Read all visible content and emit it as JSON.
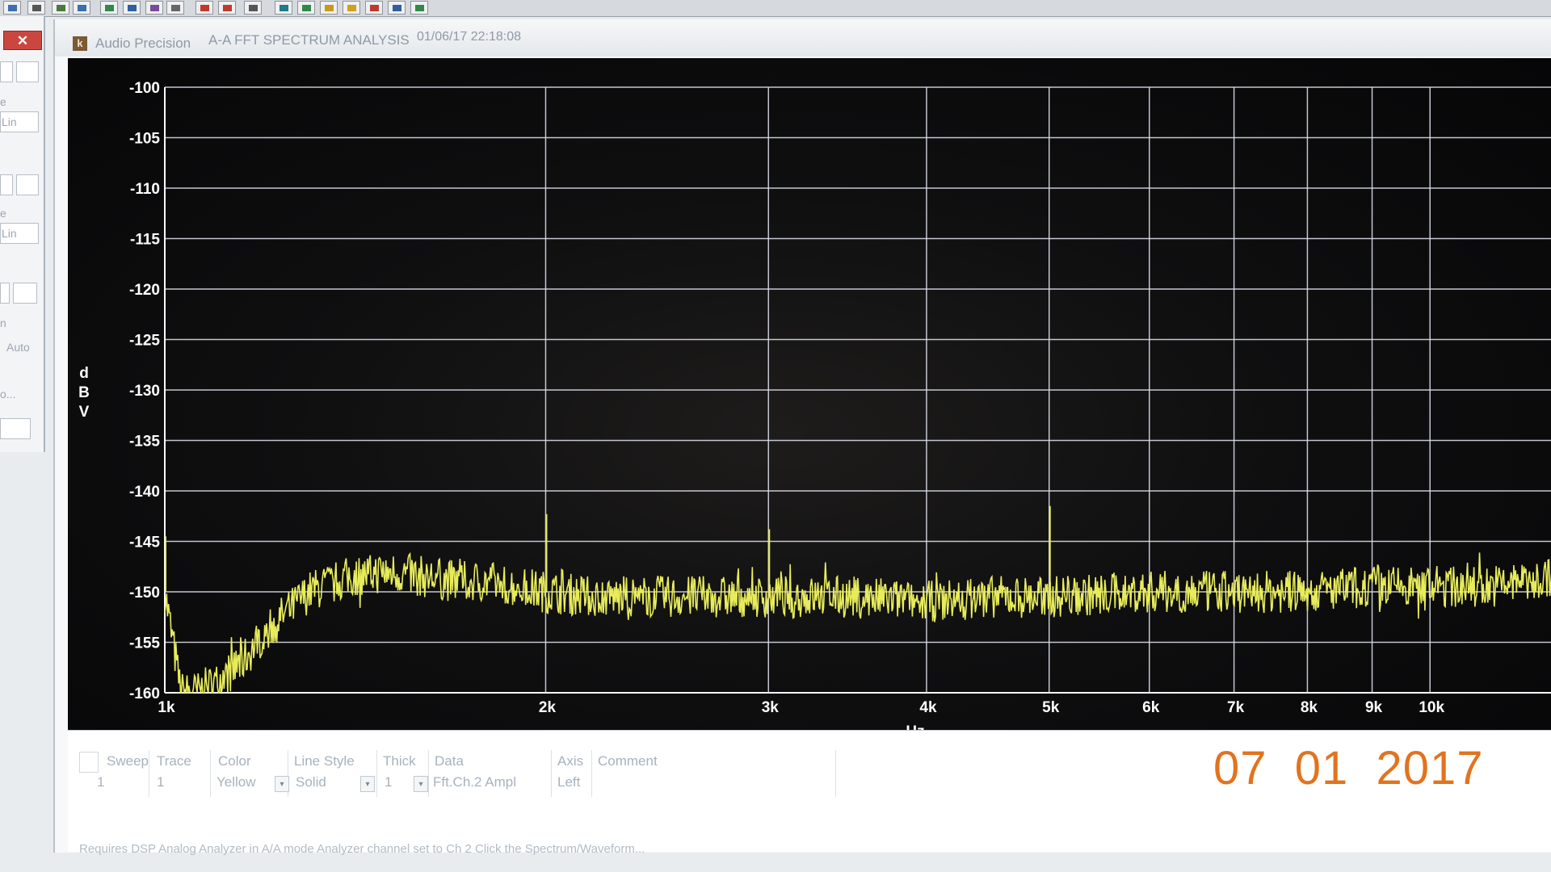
{
  "toolbar": {
    "buttons": [
      {
        "icon": "waveform-icon",
        "color": "#3a6fb0"
      },
      {
        "icon": "arrow-icon",
        "color": "#555555"
      },
      {
        "icon": "grid-icon",
        "color": "#4a7a3a"
      },
      {
        "icon": "split-icon",
        "color": "#3a6fb0"
      },
      {
        "icon": "import-icon",
        "color": "#2f8a4a"
      },
      {
        "icon": "download-icon",
        "color": "#2f5fa0"
      },
      {
        "icon": "chart-icon",
        "color": "#7a4a9a"
      },
      {
        "icon": "table-icon",
        "color": "#666666"
      },
      {
        "icon": "sweep-icon",
        "color": "#c0392b"
      },
      {
        "icon": "star-icon",
        "color": "#c0392b"
      },
      {
        "icon": "edit-icon",
        "color": "#555555"
      },
      {
        "icon": "graph-icon",
        "color": "#1f7a8c"
      },
      {
        "icon": "loop-icon",
        "color": "#2f8a4a"
      },
      {
        "icon": "scope-icon",
        "color": "#c99a1a"
      },
      {
        "icon": "bars-icon",
        "color": "#d4a017"
      },
      {
        "icon": "spectrum-icon",
        "color": "#c0392b"
      },
      {
        "icon": "monitor-icon",
        "color": "#2f5fa0"
      },
      {
        "icon": "lines-icon",
        "color": "#2f8a4a"
      }
    ]
  },
  "left_panel": {
    "close_label": "✕",
    "labels": [
      "e",
      "Lin",
      "e",
      "Lin",
      "n",
      "Auto",
      "o..."
    ]
  },
  "window": {
    "app_name": "Audio Precision",
    "analysis_name": "A-A FFT SPECTRUM ANALYSIS",
    "timestamp": "01/06/17 22:18:08"
  },
  "chart_data": {
    "type": "line",
    "title": "",
    "xlabel": "Hz",
    "ylabel": "dBV",
    "x_scale": "log",
    "xlim": [
      1000,
      12500
    ],
    "ylim": [
      -160,
      -100
    ],
    "grid": true,
    "legend": "none",
    "y_ticks": [
      -100,
      -105,
      -110,
      -115,
      -120,
      -125,
      -130,
      -135,
      -140,
      -145,
      -150,
      -155,
      -160
    ],
    "y_tick_labels": [
      "-100",
      "-105",
      "-110",
      "-115",
      "-120",
      "-125",
      "-130",
      "-135",
      "-140",
      "-145",
      "-150",
      "-155",
      "-160"
    ],
    "x_ticks": [
      1000,
      2000,
      3000,
      4000,
      5000,
      6000,
      7000,
      8000,
      9000,
      10000
    ],
    "x_tick_labels": [
      "1k",
      "2k",
      "3k",
      "4k",
      "5k",
      "6k",
      "7k",
      "8k",
      "9k",
      "10k"
    ],
    "series": [
      {
        "color": "#e8ec5a",
        "x": [
          1000,
          1030,
          1060,
          1100,
          1150,
          1200,
          1250,
          1300,
          1400,
          1500,
          1600,
          1700,
          1800,
          1900,
          2000,
          2200,
          2500,
          3000,
          3500,
          4000,
          4500,
          5000,
          6000,
          7000,
          8000,
          9000,
          10000,
          11000,
          12000,
          12500
        ],
        "values": [
          -150,
          -160,
          -160,
          -159,
          -157,
          -154,
          -152,
          -150,
          -148.5,
          -148,
          -148.5,
          -149,
          -149,
          -149.5,
          -150,
          -150.5,
          -150.5,
          -150.5,
          -150.5,
          -151,
          -150.5,
          -150.5,
          -150,
          -150,
          -150,
          -149.5,
          -149.5,
          -149.5,
          -149,
          -148.5
        ]
      }
    ],
    "spikes": [
      {
        "x": 2000,
        "value": -142.3
      },
      {
        "x": 3000,
        "value": -143.8
      },
      {
        "x": 5000,
        "value": -141.5
      },
      {
        "x": 1000,
        "value": -144.5
      }
    ]
  },
  "legend_table": {
    "headers": [
      "Sweep",
      "Trace",
      "Color",
      "Line Style",
      "Thick",
      "Data",
      "Axis",
      "Comment"
    ],
    "row": {
      "sweep": "1",
      "trace": "1",
      "color": "Yellow",
      "line_style": "Solid",
      "thick": "1",
      "data": "Fft.Ch.2 Ampl",
      "axis": "Left"
    }
  },
  "status_bar": {
    "text": "Requires DSP  Analog Analyzer in A/A mode  Analyzer channel set to Ch 2  Click the Spectrum/Waveform..."
  },
  "photo_date": "07  01  2017"
}
